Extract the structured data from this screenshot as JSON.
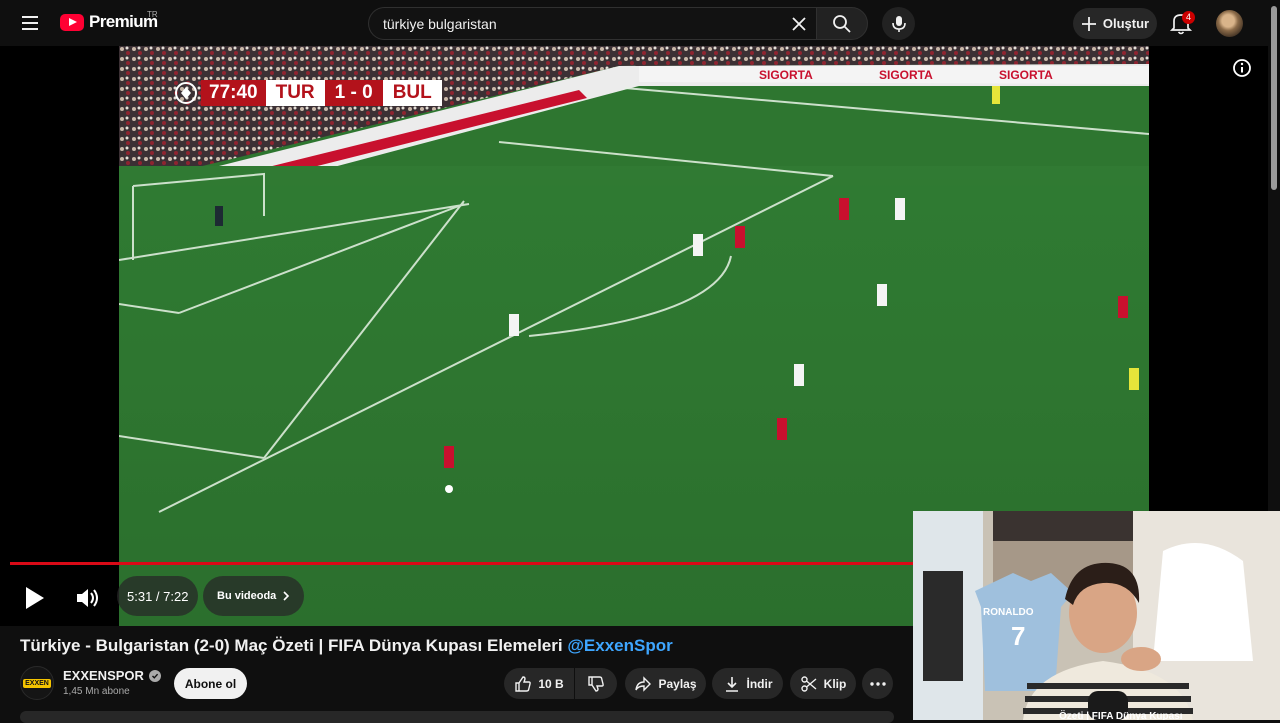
{
  "header": {
    "logo_text": "Premium",
    "region": "TR",
    "search_value": "türkiye bulgaristan",
    "create_label": "Oluştur",
    "notification_count": "4"
  },
  "player": {
    "scorebug": {
      "clock": "77:40",
      "home": "TUR",
      "score": "1 - 0",
      "away": "BUL"
    },
    "time_display": "5:31 / 7:22",
    "chapter_label": "Bu videoda",
    "progress": 0.75,
    "brand_color": "#d90a17"
  },
  "video": {
    "title": "Türkiye - Bulgaristan (2-0) Maç Özeti | FIFA Dünya Kupası Elemeleri ",
    "handle": "@ExxenSpor",
    "channel_name": "EXXENSPOR",
    "channel_avatar_text": "EXXEN",
    "subscribers": "1,45 Mn abone",
    "subscribe_label": "Abone ol",
    "likes": "10 B",
    "share_label": "Paylaş",
    "download_label": "İndir",
    "clip_label": "Klip"
  },
  "webcam": {
    "jersey_name": "RONALDO",
    "jersey_number": "7",
    "overlay_text": "Özeti | FIFA Dünya Kupası"
  }
}
